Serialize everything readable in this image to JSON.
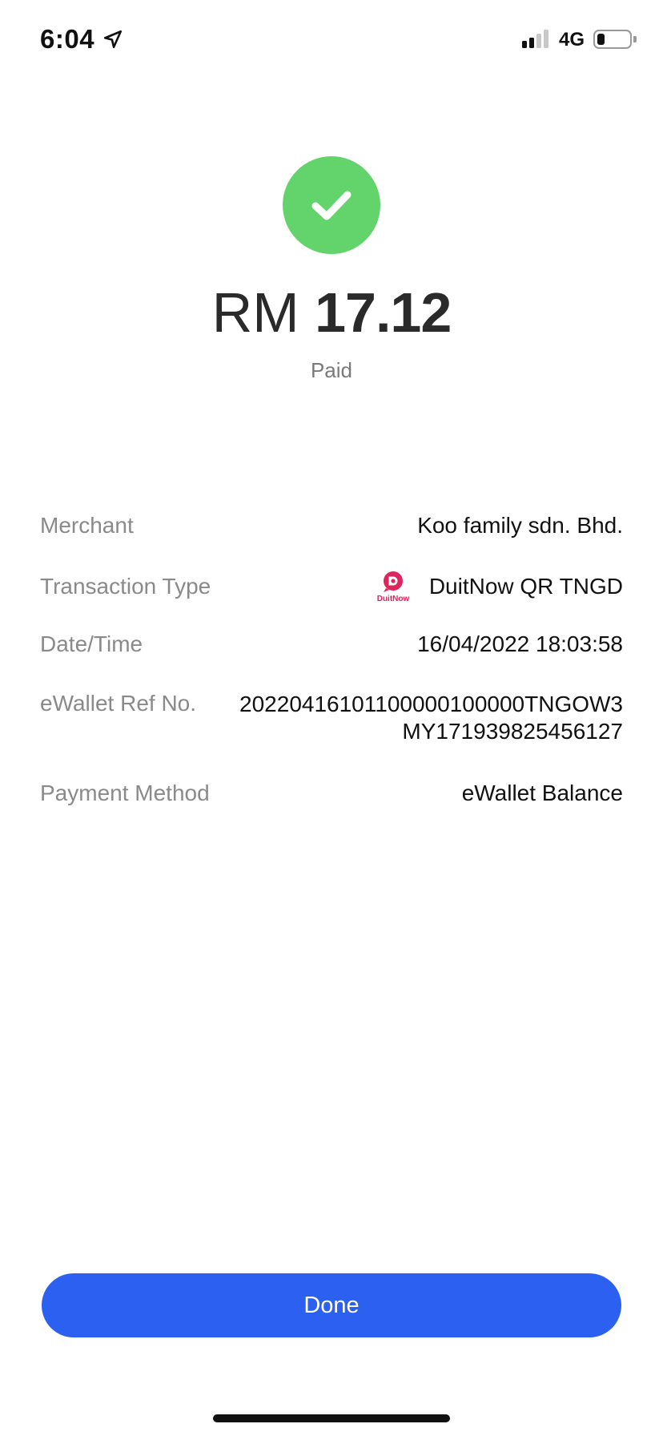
{
  "status_bar": {
    "time": "6:04",
    "network": "4G",
    "location_icon": "location-arrow-icon",
    "battery_level_fraction": 0.25
  },
  "header": {
    "status_icon": "checkmark-circle-icon",
    "status_color": "#63d46b",
    "currency": "RM",
    "amount": "17.12",
    "status_text": "Paid"
  },
  "details": {
    "merchant": {
      "label": "Merchant",
      "value": "Koo family sdn. Bhd."
    },
    "transaction_type": {
      "label": "Transaction Type",
      "logo_text": "DuitNow",
      "value": "DuitNow QR TNGD"
    },
    "datetime": {
      "label": "Date/Time",
      "value": "16/04/2022 18:03:58"
    },
    "ref_no": {
      "label": "eWallet Ref No.",
      "line1": "20220416101100000100000TNGOW3",
      "line2": "MY171939825456127"
    },
    "payment_method": {
      "label": "Payment Method",
      "value": "eWallet Balance"
    }
  },
  "footer": {
    "done_label": "Done",
    "accent_color": "#2b60f0"
  }
}
